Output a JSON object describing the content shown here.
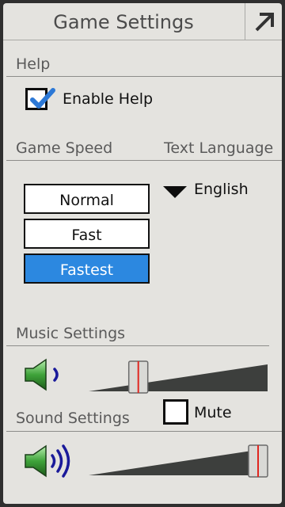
{
  "header": {
    "title": "Game Settings",
    "corner_icon": "arrow-up-right-icon"
  },
  "help": {
    "section_label": "Help",
    "enable_help_label": "Enable Help",
    "enable_help_checked": true
  },
  "game_speed": {
    "section_label": "Game Speed",
    "options": [
      "Normal",
      "Fast",
      "Fastest"
    ],
    "selected": "Fastest"
  },
  "text_language": {
    "section_label": "Text Language",
    "value": "English",
    "icon": "dropdown-triangle-icon"
  },
  "music": {
    "section_label": "Music Settings",
    "volume": 0.15,
    "icon": "speaker-low-icon"
  },
  "mute": {
    "label": "Mute",
    "checked": false
  },
  "sound": {
    "section_label": "Sound Settings",
    "volume": 1.0,
    "icon": "speaker-high-icon"
  },
  "colors": {
    "accent": "#2c88e0",
    "background": "#e4e3df",
    "slider_marker": "#e0261f"
  }
}
